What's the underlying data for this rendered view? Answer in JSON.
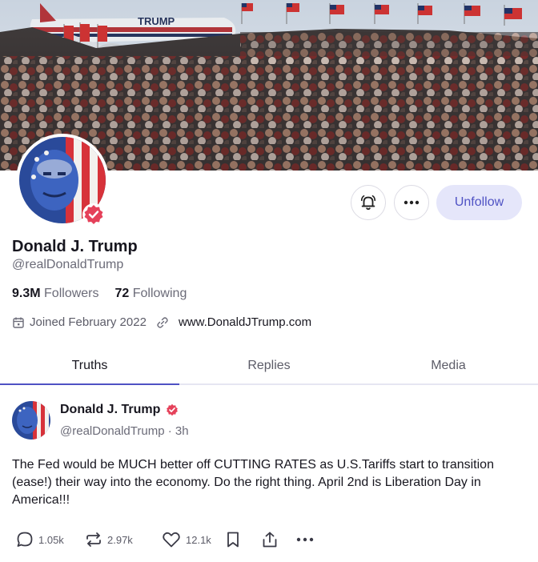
{
  "banner": {
    "plane_text": "TRUMP"
  },
  "profile": {
    "name": "Donald J. Trump",
    "handle": "@realDonaldTrump",
    "followers_count": "9.3M",
    "followers_label": "Followers",
    "following_count": "72",
    "following_label": "Following",
    "joined": "Joined February 2022",
    "website": "www.DonaldJTrump.com"
  },
  "actions": {
    "unfollow_label": "Unfollow",
    "more_label": "•••"
  },
  "tabs": [
    {
      "label": "Truths",
      "active": true
    },
    {
      "label": "Replies",
      "active": false
    },
    {
      "label": "Media",
      "active": false
    }
  ],
  "post": {
    "author": "Donald J. Trump",
    "meta": "@realDonaldTrump · 3h",
    "text": "The Fed would be MUCH better off CUTTING RATES as U.S.Tariffs start to transition (ease!) their way into the economy. Do the right thing. April 2nd is Liberation Day in America!!!",
    "replies": "1.05k",
    "retruths": "2.97k",
    "likes": "12.1k",
    "more_label": "•••"
  },
  "colors": {
    "accent": "#4f52c4",
    "verified": "#e5415a",
    "unfollow_bg": "#e5e6fa"
  },
  "icons": [
    "bell-icon",
    "more-icon",
    "calendar-icon",
    "link-icon",
    "verified-badge-icon",
    "reply-icon",
    "retruth-icon",
    "heart-icon",
    "bookmark-icon",
    "share-icon"
  ]
}
